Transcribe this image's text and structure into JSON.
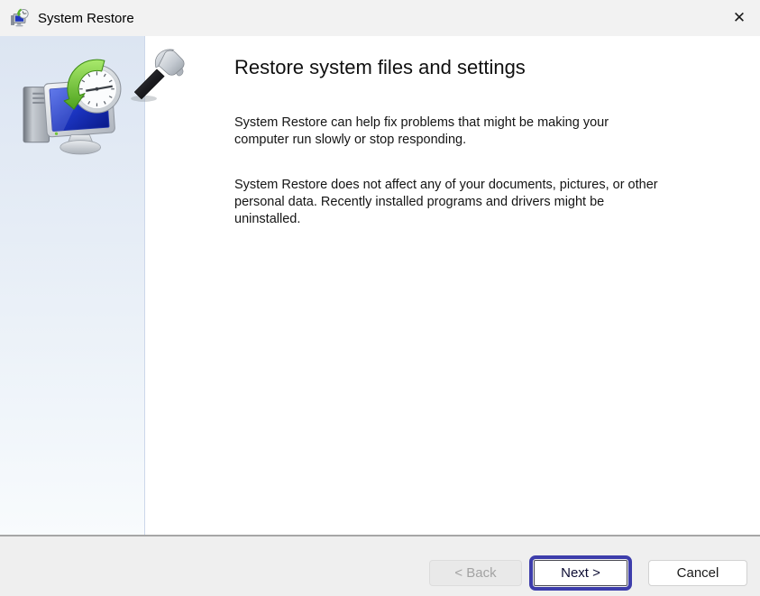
{
  "window": {
    "title": "System Restore",
    "close_glyph": "✕"
  },
  "content": {
    "heading": "Restore system files and settings",
    "paragraphs": [
      "System Restore can help fix problems that might be making your\ncomputer run slowly or stop responding.",
      "System Restore does not affect any of your documents, pictures, or other\npersonal data. Recently installed programs and drivers might be\nuninstalled."
    ]
  },
  "footer": {
    "back": "< Back",
    "next": "Next >",
    "cancel": "Cancel"
  },
  "icons": {
    "app_icon": "system-restore-computer-clock",
    "side_illustration": "computer-with-restore-clock",
    "decoration": "hammer"
  },
  "colors": {
    "titlebar_bg": "#f2f2f2",
    "sidebar_gradient_top": "#dce5f2",
    "sidebar_gradient_bottom": "#f8fbfd",
    "footer_bg": "#efefef",
    "footer_separator": "#a6a6a6",
    "focus_ring": "#3d3dab",
    "disabled_text": "#a3a3a3",
    "screen_blue": "#1b34c0",
    "arrow_green": "#4da21d"
  }
}
